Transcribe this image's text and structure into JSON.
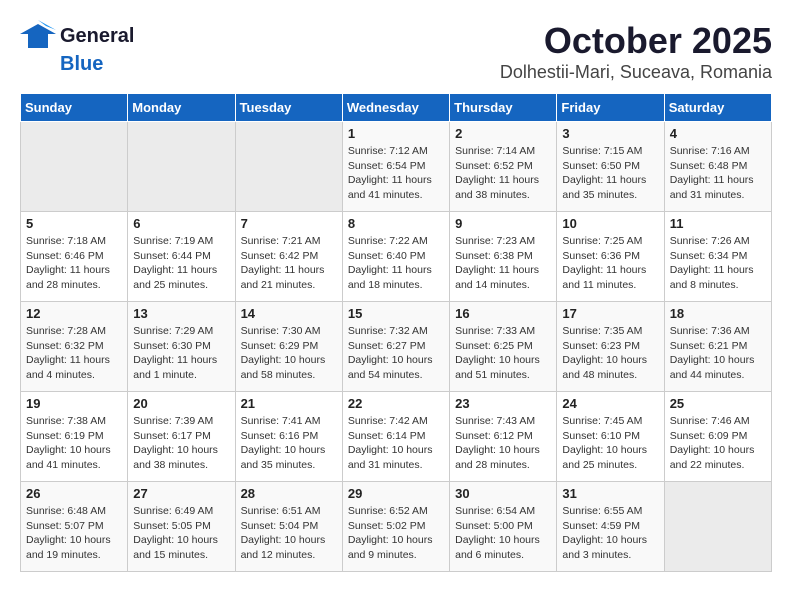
{
  "logo": {
    "general": "General",
    "blue": "Blue"
  },
  "title": "October 2025",
  "subtitle": "Dolhestii-Mari, Suceava, Romania",
  "weekdays": [
    "Sunday",
    "Monday",
    "Tuesday",
    "Wednesday",
    "Thursday",
    "Friday",
    "Saturday"
  ],
  "weeks": [
    [
      {
        "day": null
      },
      {
        "day": null
      },
      {
        "day": null
      },
      {
        "day": "1",
        "sunrise": "7:12 AM",
        "sunset": "6:54 PM",
        "daylight": "11 hours and 41 minutes."
      },
      {
        "day": "2",
        "sunrise": "7:14 AM",
        "sunset": "6:52 PM",
        "daylight": "11 hours and 38 minutes."
      },
      {
        "day": "3",
        "sunrise": "7:15 AM",
        "sunset": "6:50 PM",
        "daylight": "11 hours and 35 minutes."
      },
      {
        "day": "4",
        "sunrise": "7:16 AM",
        "sunset": "6:48 PM",
        "daylight": "11 hours and 31 minutes."
      }
    ],
    [
      {
        "day": "5",
        "sunrise": "7:18 AM",
        "sunset": "6:46 PM",
        "daylight": "11 hours and 28 minutes."
      },
      {
        "day": "6",
        "sunrise": "7:19 AM",
        "sunset": "6:44 PM",
        "daylight": "11 hours and 25 minutes."
      },
      {
        "day": "7",
        "sunrise": "7:21 AM",
        "sunset": "6:42 PM",
        "daylight": "11 hours and 21 minutes."
      },
      {
        "day": "8",
        "sunrise": "7:22 AM",
        "sunset": "6:40 PM",
        "daylight": "11 hours and 18 minutes."
      },
      {
        "day": "9",
        "sunrise": "7:23 AM",
        "sunset": "6:38 PM",
        "daylight": "11 hours and 14 minutes."
      },
      {
        "day": "10",
        "sunrise": "7:25 AM",
        "sunset": "6:36 PM",
        "daylight": "11 hours and 11 minutes."
      },
      {
        "day": "11",
        "sunrise": "7:26 AM",
        "sunset": "6:34 PM",
        "daylight": "11 hours and 8 minutes."
      }
    ],
    [
      {
        "day": "12",
        "sunrise": "7:28 AM",
        "sunset": "6:32 PM",
        "daylight": "11 hours and 4 minutes."
      },
      {
        "day": "13",
        "sunrise": "7:29 AM",
        "sunset": "6:30 PM",
        "daylight": "11 hours and 1 minute."
      },
      {
        "day": "14",
        "sunrise": "7:30 AM",
        "sunset": "6:29 PM",
        "daylight": "10 hours and 58 minutes."
      },
      {
        "day": "15",
        "sunrise": "7:32 AM",
        "sunset": "6:27 PM",
        "daylight": "10 hours and 54 minutes."
      },
      {
        "day": "16",
        "sunrise": "7:33 AM",
        "sunset": "6:25 PM",
        "daylight": "10 hours and 51 minutes."
      },
      {
        "day": "17",
        "sunrise": "7:35 AM",
        "sunset": "6:23 PM",
        "daylight": "10 hours and 48 minutes."
      },
      {
        "day": "18",
        "sunrise": "7:36 AM",
        "sunset": "6:21 PM",
        "daylight": "10 hours and 44 minutes."
      }
    ],
    [
      {
        "day": "19",
        "sunrise": "7:38 AM",
        "sunset": "6:19 PM",
        "daylight": "10 hours and 41 minutes."
      },
      {
        "day": "20",
        "sunrise": "7:39 AM",
        "sunset": "6:17 PM",
        "daylight": "10 hours and 38 minutes."
      },
      {
        "day": "21",
        "sunrise": "7:41 AM",
        "sunset": "6:16 PM",
        "daylight": "10 hours and 35 minutes."
      },
      {
        "day": "22",
        "sunrise": "7:42 AM",
        "sunset": "6:14 PM",
        "daylight": "10 hours and 31 minutes."
      },
      {
        "day": "23",
        "sunrise": "7:43 AM",
        "sunset": "6:12 PM",
        "daylight": "10 hours and 28 minutes."
      },
      {
        "day": "24",
        "sunrise": "7:45 AM",
        "sunset": "6:10 PM",
        "daylight": "10 hours and 25 minutes."
      },
      {
        "day": "25",
        "sunrise": "7:46 AM",
        "sunset": "6:09 PM",
        "daylight": "10 hours and 22 minutes."
      }
    ],
    [
      {
        "day": "26",
        "sunrise": "6:48 AM",
        "sunset": "5:07 PM",
        "daylight": "10 hours and 19 minutes."
      },
      {
        "day": "27",
        "sunrise": "6:49 AM",
        "sunset": "5:05 PM",
        "daylight": "10 hours and 15 minutes."
      },
      {
        "day": "28",
        "sunrise": "6:51 AM",
        "sunset": "5:04 PM",
        "daylight": "10 hours and 12 minutes."
      },
      {
        "day": "29",
        "sunrise": "6:52 AM",
        "sunset": "5:02 PM",
        "daylight": "10 hours and 9 minutes."
      },
      {
        "day": "30",
        "sunrise": "6:54 AM",
        "sunset": "5:00 PM",
        "daylight": "10 hours and 6 minutes."
      },
      {
        "day": "31",
        "sunrise": "6:55 AM",
        "sunset": "4:59 PM",
        "daylight": "10 hours and 3 minutes."
      },
      {
        "day": null
      }
    ]
  ]
}
